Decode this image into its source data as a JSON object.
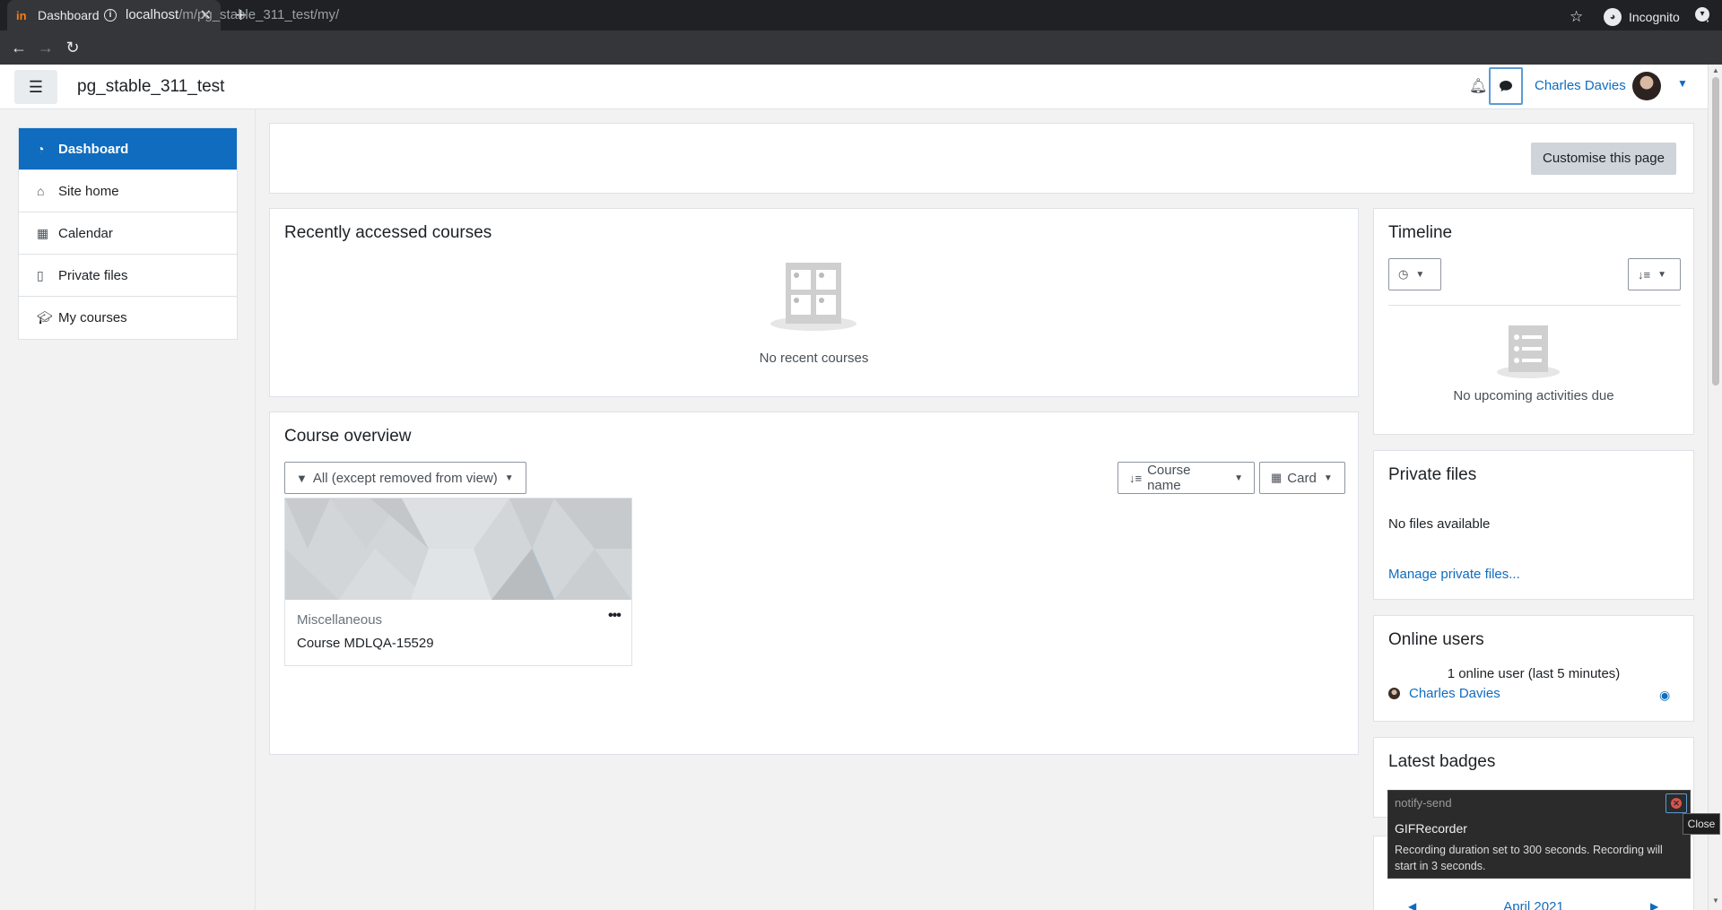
{
  "browser": {
    "tab_title": "Dashboard",
    "tab_favicon": "in",
    "url_host": "localhost",
    "url_path": "/m/pg_stable_311_test/my/",
    "incognito_label": "Incognito"
  },
  "navbar": {
    "site_name": "pg_stable_311_test",
    "user_name": "Charles Davies"
  },
  "nav": {
    "items": [
      {
        "label": "Dashboard",
        "icon": "dashboard-icon"
      },
      {
        "label": "Site home",
        "icon": "home-icon"
      },
      {
        "label": "Calendar",
        "icon": "calendar-icon"
      },
      {
        "label": "Private files",
        "icon": "file-icon"
      },
      {
        "label": "My courses",
        "icon": "graduation-cap-icon"
      }
    ]
  },
  "page": {
    "customise_label": "Customise this page"
  },
  "recent": {
    "title": "Recently accessed courses",
    "empty": "No recent courses"
  },
  "overview": {
    "title": "Course overview",
    "filter": "All (except removed from view)",
    "sort": "Course name",
    "view": "Card",
    "courses": [
      {
        "category": "Miscellaneous",
        "name": "Course MDLQA-15529"
      }
    ]
  },
  "timeline": {
    "title": "Timeline",
    "empty": "No upcoming activities due"
  },
  "private_files": {
    "title": "Private files",
    "empty": "No files available",
    "manage_link": "Manage private files..."
  },
  "online_users": {
    "title": "Online users",
    "summary": "1 online user (last 5 minutes)",
    "user": "Charles Davies"
  },
  "badges": {
    "title": "Latest badges"
  },
  "calendar": {
    "month": "April 2021"
  },
  "notification": {
    "app": "notify-send",
    "summary": "GIFRecorder",
    "body": "Recording duration set to 300 seconds. Recording will start in 3 seconds.",
    "tooltip": "Close"
  },
  "colors": {
    "primary": "#0f6cbf",
    "secondary_button": "#ced4da",
    "page_bg": "#f2f2f2"
  }
}
